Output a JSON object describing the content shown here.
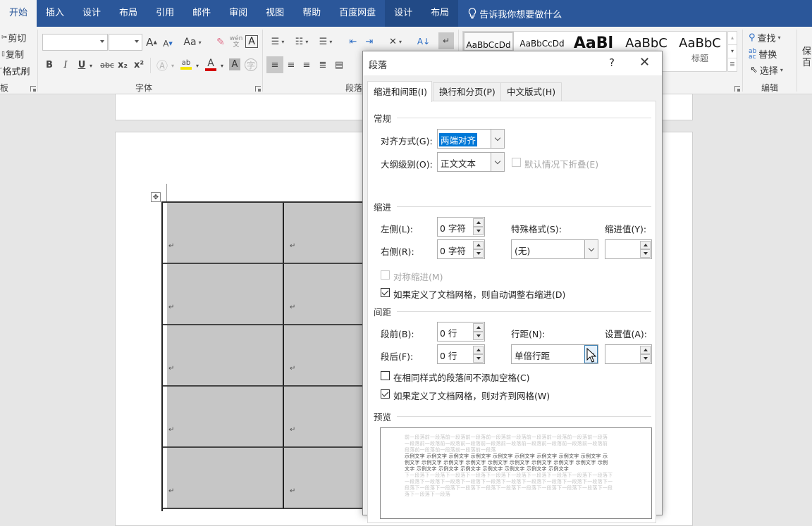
{
  "tabs": [
    {
      "label": "开始",
      "active": true
    },
    {
      "label": "插入"
    },
    {
      "label": "设计"
    },
    {
      "label": "布局"
    },
    {
      "label": "引用"
    },
    {
      "label": "邮件"
    },
    {
      "label": "审阅"
    },
    {
      "label": "视图"
    },
    {
      "label": "帮助"
    },
    {
      "label": "百度网盘"
    },
    {
      "label": "设计",
      "contextual": true
    },
    {
      "label": "布局",
      "contextual": true
    }
  ],
  "tell_me": "告诉我你想要做什么",
  "ribbon": {
    "clipboard": {
      "cut": "剪切",
      "copy": "复制",
      "format_painter": "格式刷",
      "label": "板"
    },
    "font": {
      "label": "字体",
      "font_name": "",
      "font_size": "",
      "change_case": "Aa",
      "bold": "B",
      "italic": "I",
      "underline": "U",
      "strike": "abc",
      "subscript": "x₂",
      "superscript": "x²"
    },
    "paragraph": {
      "label": "段落"
    },
    "styles": {
      "items": [
        {
          "preview": "AaBbCcDd",
          "name": ""
        },
        {
          "preview": "AaBbCcDd",
          "name": ""
        },
        {
          "preview": "AaBl",
          "name": ""
        },
        {
          "preview": "AaBbC",
          "name": ""
        },
        {
          "preview": "AaBbC",
          "name": "标题"
        }
      ]
    },
    "editing": {
      "find": "查找",
      "replace": "替换",
      "select": "选择",
      "label": "编辑"
    },
    "baidu": {
      "line1": "保",
      "line2": "百"
    }
  },
  "colors": {
    "tab_bar": "#2b579a",
    "highlight_yellow": "#f5e600",
    "font_red": "#d40000",
    "selection_blue": "#0078d7"
  },
  "document": {
    "table_rows": 5,
    "table_cols": 2,
    "para_mark": "↵"
  },
  "dialog": {
    "title": "段落",
    "help": "?",
    "close": "✕",
    "tabs": [
      {
        "label": "缩进和间距(I)",
        "active": true
      },
      {
        "label": "换行和分页(P)"
      },
      {
        "label": "中文版式(H)"
      }
    ],
    "general": {
      "section": "常规",
      "alignment_label": "对齐方式(G):",
      "alignment_value": "两端对齐",
      "outline_label": "大纲级别(O):",
      "outline_value": "正文文本",
      "collapse_label": "默认情况下折叠(E)",
      "collapse_checked": false,
      "collapse_disabled": true
    },
    "indent": {
      "section": "缩进",
      "left_label": "左侧(L):",
      "left_value": "0 字符",
      "right_label": "右侧(R):",
      "right_value": "0 字符",
      "special_label": "特殊格式(S):",
      "special_value": "(无)",
      "by_label": "缩进值(Y):",
      "by_value": "",
      "mirror_label": "对称缩进(M)",
      "mirror_checked": false,
      "mirror_disabled": true,
      "auto_adjust_label": "如果定义了文档网格，则自动调整右缩进(D)",
      "auto_adjust_checked": true
    },
    "spacing": {
      "section": "间距",
      "before_label": "段前(B):",
      "before_value": "0 行",
      "after_label": "段后(F):",
      "after_value": "0 行",
      "line_label": "行距(N):",
      "line_value": "单倍行距",
      "at_label": "设置值(A):",
      "at_value": "",
      "no_space_label": "在相同样式的段落间不添加空格(C)",
      "no_space_checked": false,
      "snap_grid_label": "如果定义了文档网格，则对齐到网格(W)",
      "snap_grid_checked": true
    },
    "preview": {
      "section": "预览",
      "prev_lines": [
        "前一段落前一段落前一段落前一段落前一段落前一段落前一段落前一段落前一段落前一段落",
        "一段落前一段落前一段落前一段落前一段落前一段落前一段落前一段落前一段落前一段落前",
        "段落前一段落前一段落前一段落前一段落"
      ],
      "sample_lines": [
        "示例文字 示例文字 示例文字 示例文字 示例文字 示例文字 示例文字 示例文字 示例文字 示",
        "例文字 示例文字 示例文字 示例文字 示例文字 示例文字 示例文字 示例文字 示例文字 示例",
        "文字 示例文字 示例文字 示例文字 示例文字 示例文字 示例文字 示例文字"
      ],
      "next_lines": [
        "下一段落下一段落下一段落下一段落下一段落下一段落下一段落下一段落下一段落下一段落下",
        "一段落下一段落下一段落下一段落下一段落下一段落下一段落下一段落下一段落下一段落下一",
        "段落下一段落下一段落下一段落下一段落下一段落下一段落下一段落下一段落下一段落下一段",
        "落下一段落下一段落"
      ]
    }
  }
}
